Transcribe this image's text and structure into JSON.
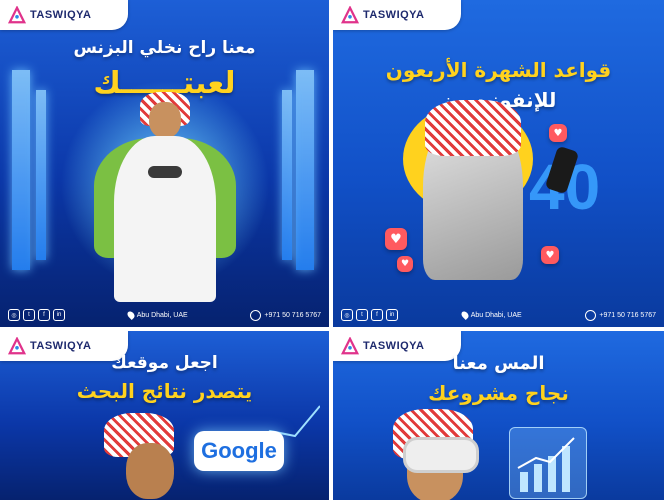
{
  "brand": "TASWIQYA",
  "tiles": [
    {
      "headline": "معنا راح نخلي البزنس",
      "highlight": "لعبتــــــك",
      "location": "Abu Dhabi, UAE",
      "phone": "+971 50 716 5767"
    },
    {
      "headline": "قواعد الشهرة الأربعون",
      "subline": "للإنفونـسرز",
      "big_number": "40",
      "location": "Abu Dhabi, UAE",
      "phone": "+971 50 716 5767"
    },
    {
      "headline": "اجعل موقعك",
      "highlight": "يتصدر نتائج البحث",
      "search_brand": "Google"
    },
    {
      "headline": "المس معنا",
      "highlight": "نجاح مشروعك"
    }
  ],
  "socials": [
    "instagram-icon",
    "twitter-icon",
    "facebook-icon",
    "linkedin-icon"
  ],
  "colors": {
    "accent_yellow": "#ffd21e",
    "background_blue": "#0b37a8",
    "heart_red": "#ff5a5f"
  }
}
